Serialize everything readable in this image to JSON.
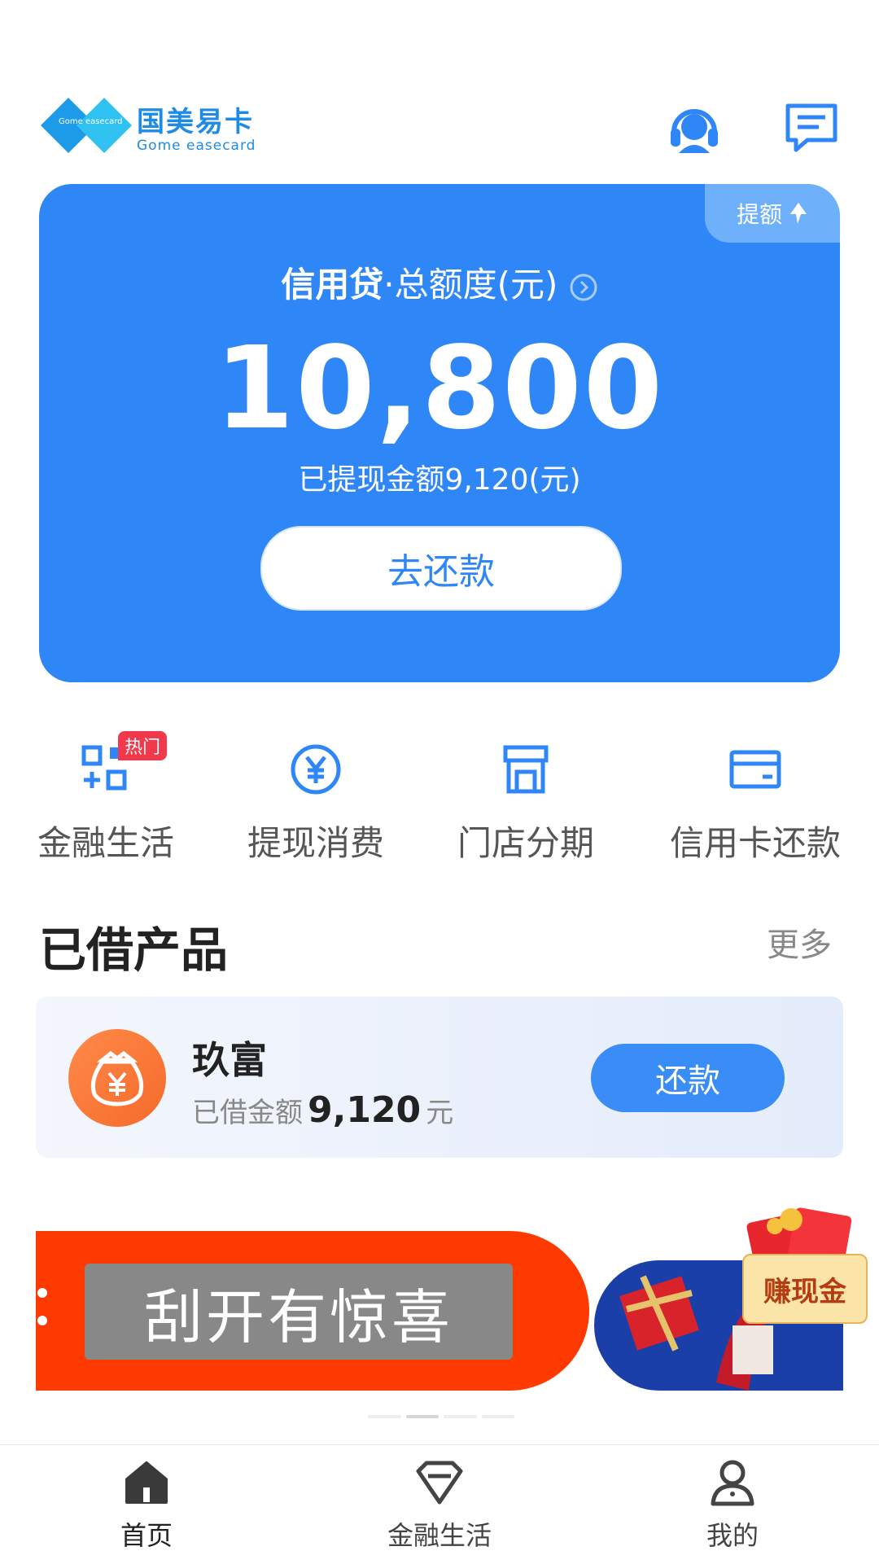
{
  "header": {
    "logo_cn": "国美易卡",
    "logo_en": "Gome easecard",
    "logo_mark": "Gome easecard",
    "support_icon": "headset-icon",
    "message_icon": "message-icon"
  },
  "credit": {
    "raise_label": "提额",
    "title_bold": "信用贷",
    "title_rest": "·总额度(元)",
    "total": "10,800",
    "withdrawn_text": "已提现金额9,120(元)",
    "repay_label": "去还款"
  },
  "quick_actions": [
    {
      "label": "金融生活",
      "icon": "apps-icon",
      "badge": "热门"
    },
    {
      "label": "提现消费",
      "icon": "yuan-icon"
    },
    {
      "label": "门店分期",
      "icon": "store-icon"
    },
    {
      "label": "信用卡还款",
      "icon": "card-icon"
    }
  ],
  "borrowed": {
    "title": "已借产品",
    "more": "更多",
    "product": {
      "name": "玖富",
      "amount_label": "已借金额",
      "amount": "9,120",
      "unit": "元",
      "button": "还款"
    }
  },
  "banner": {
    "scratch_text": "刮开有惊喜",
    "earn_label": "赚现金",
    "page_count": 4,
    "active_page": 2
  },
  "tabbar": [
    {
      "label": "首页",
      "icon": "home-icon",
      "active": true
    },
    {
      "label": "金融生活",
      "icon": "diamond-icon",
      "active": false
    },
    {
      "label": "我的",
      "icon": "user-icon",
      "active": false
    }
  ],
  "colors": {
    "primary": "#2f86f6",
    "logo": "#1e8be6",
    "hot_badge": "#f2394b",
    "banner_red": "#ff3a00"
  }
}
